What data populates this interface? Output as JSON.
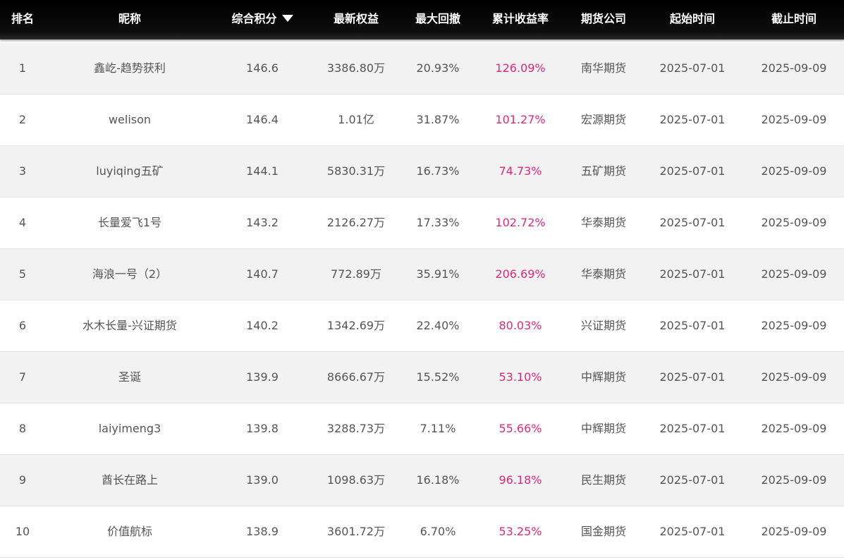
{
  "header": {
    "rank": "排名",
    "nickname": "昵称",
    "score": "综合积分",
    "equity": "最新权益",
    "drawdown": "最大回撤",
    "return": "累计收益率",
    "company": "期货公司",
    "start": "起始时间",
    "end": "截止时间"
  },
  "colors": {
    "header_bg": "#000000",
    "header_text": "#ffffff",
    "row_alt_bg": "#f2f2f2",
    "text": "#555555",
    "return_text": "#e0287a"
  },
  "rows": [
    {
      "rank": "1",
      "nickname": "鑫屹-趋势获利",
      "score": "146.6",
      "equity": "3386.80万",
      "drawdown": "20.93%",
      "return": "126.09%",
      "company": "南华期货",
      "start": "2025-07-01",
      "end": "2025-09-09"
    },
    {
      "rank": "2",
      "nickname": "welison",
      "score": "146.4",
      "equity": "1.01亿",
      "drawdown": "31.87%",
      "return": "101.27%",
      "company": "宏源期货",
      "start": "2025-07-01",
      "end": "2025-09-09"
    },
    {
      "rank": "3",
      "nickname": "luyiqing五矿",
      "score": "144.1",
      "equity": "5830.31万",
      "drawdown": "16.73%",
      "return": "74.73%",
      "company": "五矿期货",
      "start": "2025-07-01",
      "end": "2025-09-09"
    },
    {
      "rank": "4",
      "nickname": "长量爱飞1号",
      "score": "143.2",
      "equity": "2126.27万",
      "drawdown": "17.33%",
      "return": "102.72%",
      "company": "华泰期货",
      "start": "2025-07-01",
      "end": "2025-09-09"
    },
    {
      "rank": "5",
      "nickname": "海浪一号（2）",
      "score": "140.7",
      "equity": "772.89万",
      "drawdown": "35.91%",
      "return": "206.69%",
      "company": "华泰期货",
      "start": "2025-07-01",
      "end": "2025-09-09"
    },
    {
      "rank": "6",
      "nickname": "水木长量-兴证期货",
      "score": "140.2",
      "equity": "1342.69万",
      "drawdown": "22.40%",
      "return": "80.03%",
      "company": "兴证期货",
      "start": "2025-07-01",
      "end": "2025-09-09"
    },
    {
      "rank": "7",
      "nickname": "圣诞",
      "score": "139.9",
      "equity": "8666.67万",
      "drawdown": "15.52%",
      "return": "53.10%",
      "company": "中辉期货",
      "start": "2025-07-01",
      "end": "2025-09-09"
    },
    {
      "rank": "8",
      "nickname": "laiyimeng3",
      "score": "139.8",
      "equity": "3288.73万",
      "drawdown": "7.11%",
      "return": "55.66%",
      "company": "中辉期货",
      "start": "2025-07-01",
      "end": "2025-09-09"
    },
    {
      "rank": "9",
      "nickname": "酋长在路上",
      "score": "139.0",
      "equity": "1098.63万",
      "drawdown": "16.18%",
      "return": "96.18%",
      "company": "民生期货",
      "start": "2025-07-01",
      "end": "2025-09-09"
    },
    {
      "rank": "10",
      "nickname": "价值航标",
      "score": "138.9",
      "equity": "3601.72万",
      "drawdown": "6.70%",
      "return": "53.25%",
      "company": "国金期货",
      "start": "2025-07-01",
      "end": "2025-09-09"
    }
  ]
}
